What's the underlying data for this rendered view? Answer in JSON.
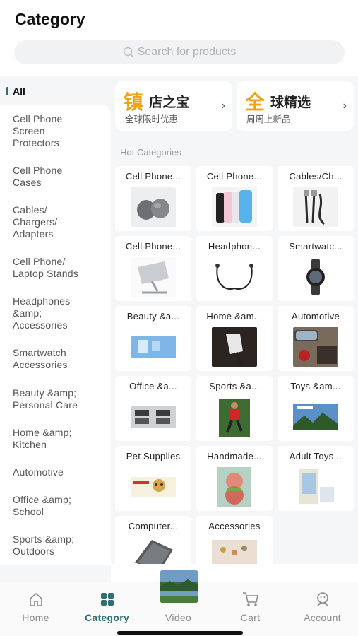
{
  "header": {
    "title": "Category"
  },
  "search": {
    "placeholder": "Search for products"
  },
  "sidebar": {
    "all_label": "All",
    "items": [
      {
        "label": "Cell Phone Screen Protectors"
      },
      {
        "label": "Cell Phone Cases"
      },
      {
        "label": "Cables/ Chargers/ Adapters"
      },
      {
        "label": "Cell Phone/ Laptop Stands"
      },
      {
        "label": "Headphones &amp; Accessories"
      },
      {
        "label": "Smartwatch Accessories"
      },
      {
        "label": "Beauty &amp; Personal Care"
      },
      {
        "label": "Home &amp; Kitchen"
      },
      {
        "label": "Automotive"
      },
      {
        "label": "Office &amp; School"
      },
      {
        "label": "Sports &amp; Outdoors"
      }
    ]
  },
  "promos": [
    {
      "big": "镇",
      "rest": "店之宝",
      "sub": "全球限时优惠"
    },
    {
      "big": "全",
      "rest": "球精选",
      "sub": "周周上新品"
    }
  ],
  "hot_categories": {
    "title": "Hot Categories",
    "items": [
      {
        "label": "Cell Phone..."
      },
      {
        "label": "Cell Phone..."
      },
      {
        "label": "Cables/Ch..."
      },
      {
        "label": "Cell Phone..."
      },
      {
        "label": "Headphon..."
      },
      {
        "label": "Smartwatc..."
      },
      {
        "label": "Beauty &a..."
      },
      {
        "label": "Home &am..."
      },
      {
        "label": "Automotive"
      },
      {
        "label": "Office &a..."
      },
      {
        "label": "Sports &a..."
      },
      {
        "label": "Toys &am..."
      },
      {
        "label": "Pet Supplies"
      },
      {
        "label": "Handmade..."
      },
      {
        "label": "Adult Toys..."
      },
      {
        "label": "Computer..."
      },
      {
        "label": "Accessories"
      }
    ]
  },
  "tabbar": {
    "items": [
      {
        "label": "Home",
        "icon": "home-icon"
      },
      {
        "label": "Category",
        "icon": "category-icon"
      },
      {
        "label": "Video",
        "icon": "video-thumbnail"
      },
      {
        "label": "Cart",
        "icon": "cart-icon"
      },
      {
        "label": "Account",
        "icon": "account-icon"
      }
    ],
    "active": "Category"
  },
  "colors": {
    "accent": "#2f6f73",
    "promo_gold": "#f0a21a",
    "background": "#f5f6f8"
  }
}
